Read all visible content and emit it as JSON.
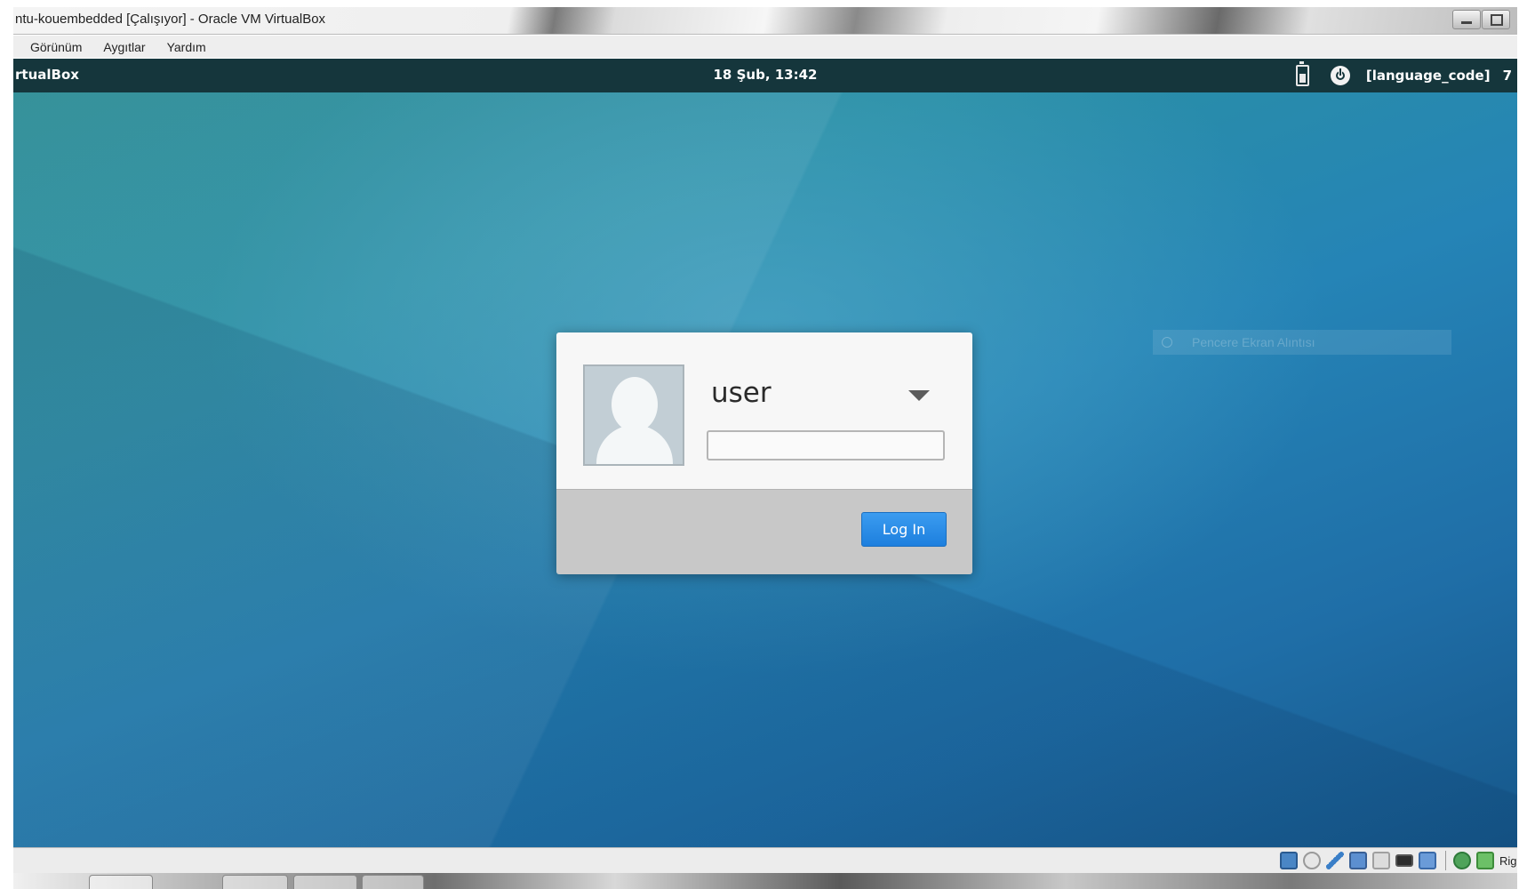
{
  "window": {
    "title": "ntu-kouembedded [Çalışıyor] - Oracle VM VirtualBox"
  },
  "menubar": {
    "items": [
      "Görünüm",
      "Aygıtlar",
      "Yardım"
    ]
  },
  "guest_panel": {
    "left_label": "rtualBox",
    "clock": "18 Şub, 13:42",
    "language": "[language_code]",
    "overflow": "7"
  },
  "ghost_notification": {
    "text": "Pencere Ekran Alıntısı"
  },
  "login": {
    "username": "user",
    "password_value": "",
    "login_button": "Log In"
  },
  "status_bar": {
    "host_key_label": "Rig",
    "icons": [
      "hard-disk-icon",
      "optical-drive-icon",
      "usb-pencil-icon",
      "network-icon",
      "shared-folder-icon",
      "display-icon",
      "video-capture-icon",
      "globe-icon",
      "host-key-arrow-icon"
    ]
  },
  "colors": {
    "panel": "#15363c",
    "login_button": "#2a8ae6",
    "desktop_top": "#2a8fa6",
    "desktop_bottom": "#16578a"
  }
}
